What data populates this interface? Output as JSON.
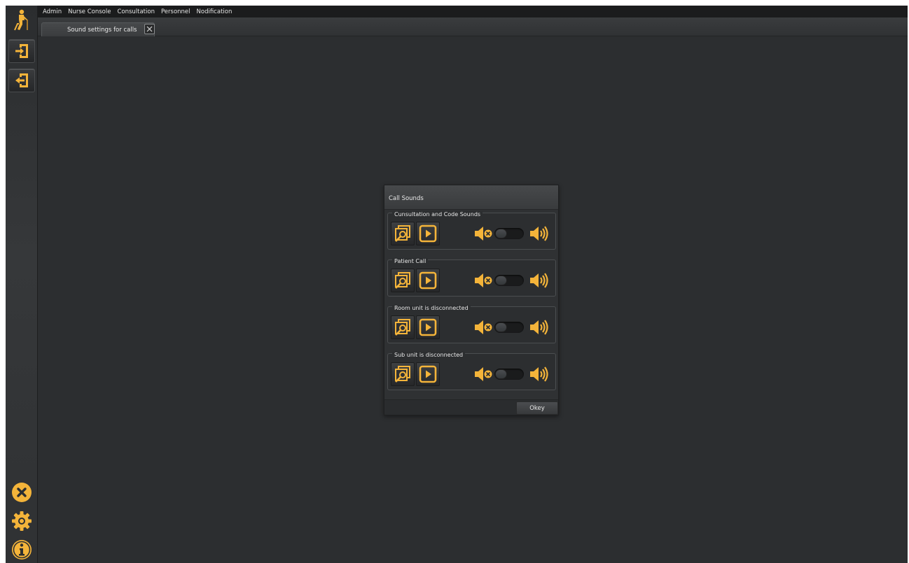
{
  "menu": [
    "Admin",
    "Nurse Console",
    "Consultation",
    "Personnel",
    "Nodification"
  ],
  "tab": {
    "label": "Sound settings for calls"
  },
  "dialog": {
    "title": "Call Sounds",
    "groups": [
      {
        "title": "Cunsultation  and  Code Sounds"
      },
      {
        "title": "Patient Call"
      },
      {
        "title": "Room  unit  is disconnected"
      },
      {
        "title": "Sub  unit  is disconnected"
      }
    ],
    "ok_label": "Okey"
  },
  "colors": {
    "accent": "#f4b43a",
    "background": "#2c2e30",
    "menubar": "#1b1c1d"
  },
  "icons": {
    "sidebar_top": [
      "person-cane-icon",
      "login-icon",
      "logout-icon"
    ],
    "sidebar_bottom": [
      "close-circle-icon",
      "gear-icon",
      "info-icon"
    ],
    "group_buttons": [
      "browse-file-icon",
      "play-icon",
      "mute-icon",
      "volume-icon"
    ]
  }
}
